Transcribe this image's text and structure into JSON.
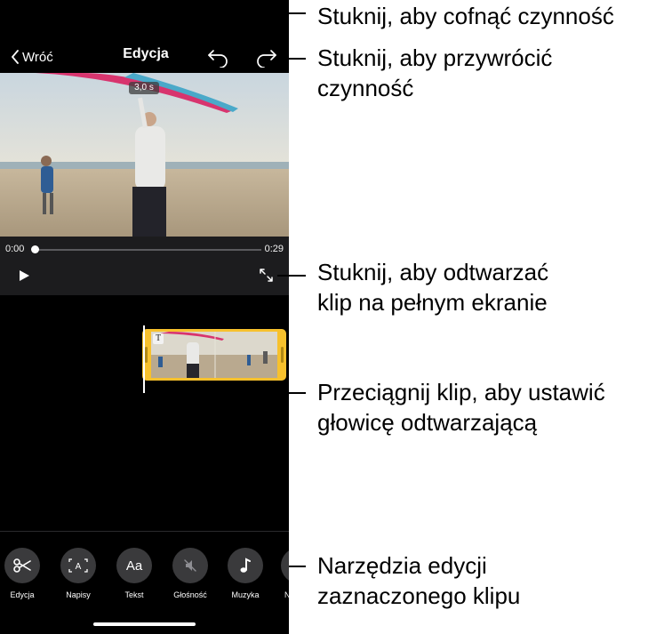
{
  "topbar": {
    "back_label": "Wróć",
    "title": "Edycja"
  },
  "video": {
    "duration_badge": "3,0 s"
  },
  "player": {
    "time_start": "0:00",
    "time_end": "0:29",
    "position_fraction": 0.0
  },
  "toolbar": {
    "tools": [
      {
        "label": "Edycja",
        "icon": "scissors-icon"
      },
      {
        "label": "Napisy",
        "icon": "captions-icon"
      },
      {
        "label": "Tekst",
        "icon": "text-icon",
        "glyph": "Aa"
      },
      {
        "label": "Głośność",
        "icon": "volume-muted-icon"
      },
      {
        "label": "Muzyka",
        "icon": "music-note-icon"
      },
      {
        "label": "N",
        "icon": "more-tool-icon"
      }
    ]
  },
  "clip": {
    "title_glyph": "T"
  },
  "callouts": {
    "undo": "Stuknij, aby cofnąć czynność",
    "redo_line1": "Stuknij, aby przywrócić",
    "redo_line2": "czynność",
    "fullscreen_line1": "Stuknij, aby odtwarzać",
    "fullscreen_line2": "klip na pełnym ekranie",
    "playhead_line1": "Przeciągnij klip, aby ustawić",
    "playhead_line2": "głowicę odtwarzającą",
    "tools_line1": "Narzędzia edycji",
    "tools_line2": "zaznaczonego klipu"
  },
  "colors": {
    "clip_border": "#f7c12d",
    "background": "#000000",
    "tool_circle": "#3a3a3c"
  }
}
